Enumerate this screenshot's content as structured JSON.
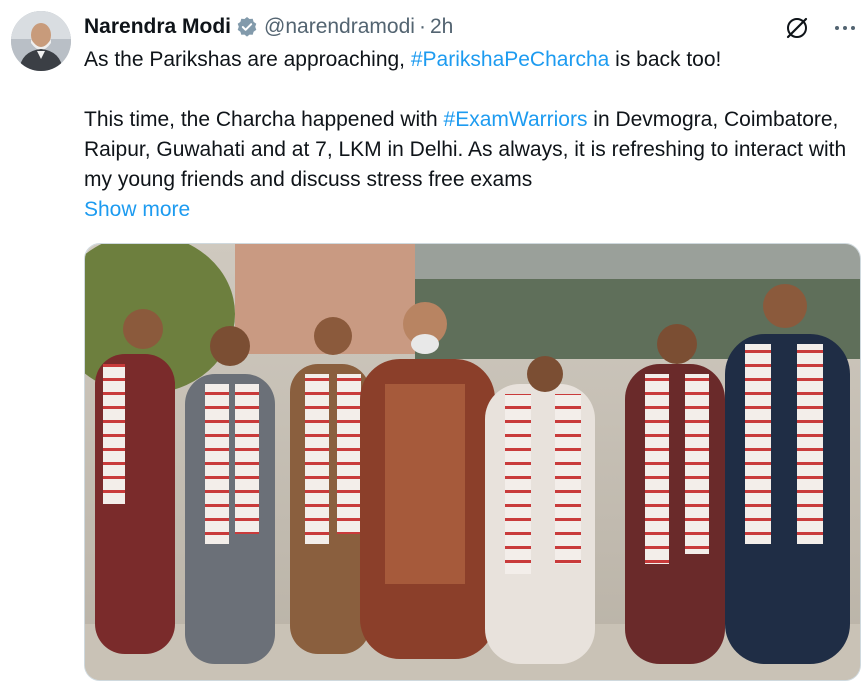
{
  "tweet": {
    "author_name": "Narendra Modi",
    "handle": "@narendramodi",
    "separator": "·",
    "time": "2h",
    "line1_before": "As the Parikshas are approaching, ",
    "line1_hashtag": "#ParikshaPeCharcha",
    "line1_after": " is back too!",
    "para2_before": "This time, the Charcha happened with ",
    "para2_hashtag": "#ExamWarriors",
    "para2_after": " in Devmogra, Coimbatore, Raipur, Guwahati and at 7, LKM in Delhi. As always, it is refreshing to interact with my young friends and discuss stress free exams",
    "show_more": "Show more"
  },
  "icons": {
    "verified": "verified-badge-icon",
    "grok": "grok-icon",
    "more": "more-options-icon"
  },
  "colors": {
    "link": "#1d9bf0",
    "secondary_text": "#536471",
    "primary_text": "#0f1419"
  }
}
